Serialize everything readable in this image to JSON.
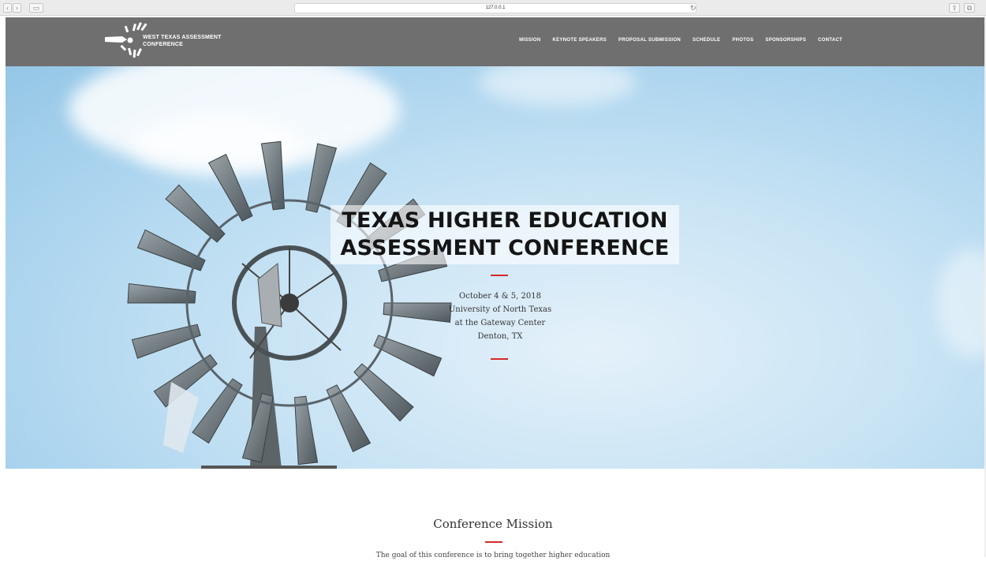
{
  "browser": {
    "url": "127.0.0.1",
    "back_icon": "chevron-left-icon",
    "forward_icon": "chevron-right-icon",
    "sidebar_icon": "sidebar-icon",
    "reload_icon": "reload-icon",
    "share_icon": "share-icon",
    "tabs_icon": "tabs-icon"
  },
  "header": {
    "logo_line1": "WEST TEXAS ASSESSMENT",
    "logo_line2": "CONFERENCE",
    "nav": [
      {
        "label": "MISSION"
      },
      {
        "label": "KEYNOTE SPEAKERS"
      },
      {
        "label": "PROPOSAL SUBMISSION"
      },
      {
        "label": "SCHEDULE"
      },
      {
        "label": "PHOTOS"
      },
      {
        "label": "SPONSORSHIPS"
      },
      {
        "label": "CONTACT"
      }
    ],
    "background": "#6f6f6f"
  },
  "hero": {
    "title_line1": "TEXAS HIGHER EDUCATION",
    "title_line2": "ASSESSMENT CONFERENCE",
    "date": "October 4 & 5, 2018",
    "venue_line1": "University of North Texas",
    "venue_line2": "at the Gateway Center",
    "city": "Denton, TX",
    "accent_color": "#d42a2a"
  },
  "mission": {
    "title": "Conference Mission",
    "text": "The goal of this conference is to bring together higher education"
  }
}
